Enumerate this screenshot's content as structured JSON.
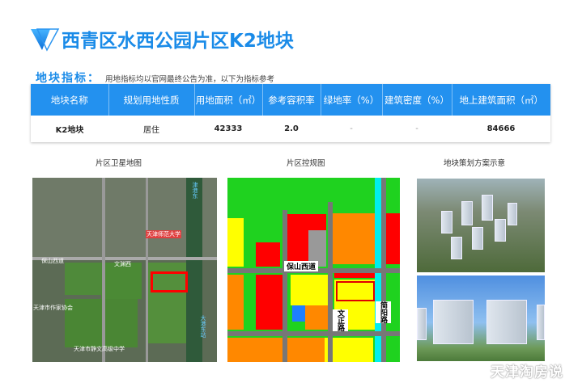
{
  "header": {
    "title": "西青区水西公园片区K2地块",
    "logo_icon": "triangle-logo-icon"
  },
  "subtitle": {
    "key": "地块指标：",
    "note": "用地指标均以官网最终公告为准，以下为指标参考"
  },
  "table": {
    "headers": [
      "地块名称",
      "规划用地性质",
      "用地面积（㎡）",
      "参考容积率",
      "绿地率（%）",
      "建筑密度（%）",
      "地上建筑面积（㎡）"
    ],
    "rows": [
      [
        "K2地块",
        "居住",
        "42333",
        "2.0",
        "-",
        "-",
        "84666"
      ]
    ]
  },
  "captions": {
    "satellite": "片区卫星地图",
    "plan": "片区控规图",
    "render": "地块策划方案示意"
  },
  "satellite_labels": [
    "天津市作家协会",
    "天津市静文高级中学",
    "文渊西",
    "天津师范大学",
    "大港东站",
    "津港东",
    "保山西道"
  ],
  "plan_roads": {
    "h": "保山西道",
    "v1": "文正路",
    "v2": "简阳路"
  },
  "watermark": "天津淘房说",
  "colors": {
    "accent": "#2391ef",
    "highlight": "#e00000"
  }
}
